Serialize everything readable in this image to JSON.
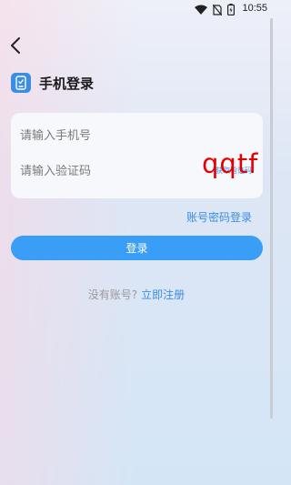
{
  "status_bar": {
    "time": "10:55",
    "icons": [
      "wifi-icon",
      "no-sim-icon",
      "battery-icon"
    ]
  },
  "header": {
    "back_icon": "chevron-left-icon",
    "title_icon": "phone-icon",
    "title": "手机登录"
  },
  "form": {
    "phone_placeholder": "请输入手机号",
    "phone_value": "",
    "code_placeholder": "请输入验证码",
    "code_value": "",
    "get_code_label": "获取验证码"
  },
  "password_login_label": "账号密码登录",
  "login_button_label": "登录",
  "register": {
    "prompt": "没有账号?",
    "link_label": "立即注册"
  },
  "watermark": "qqtf",
  "colors": {
    "accent": "#3a8ee6",
    "button": "#3a9ef7",
    "watermark": "#e40000"
  }
}
